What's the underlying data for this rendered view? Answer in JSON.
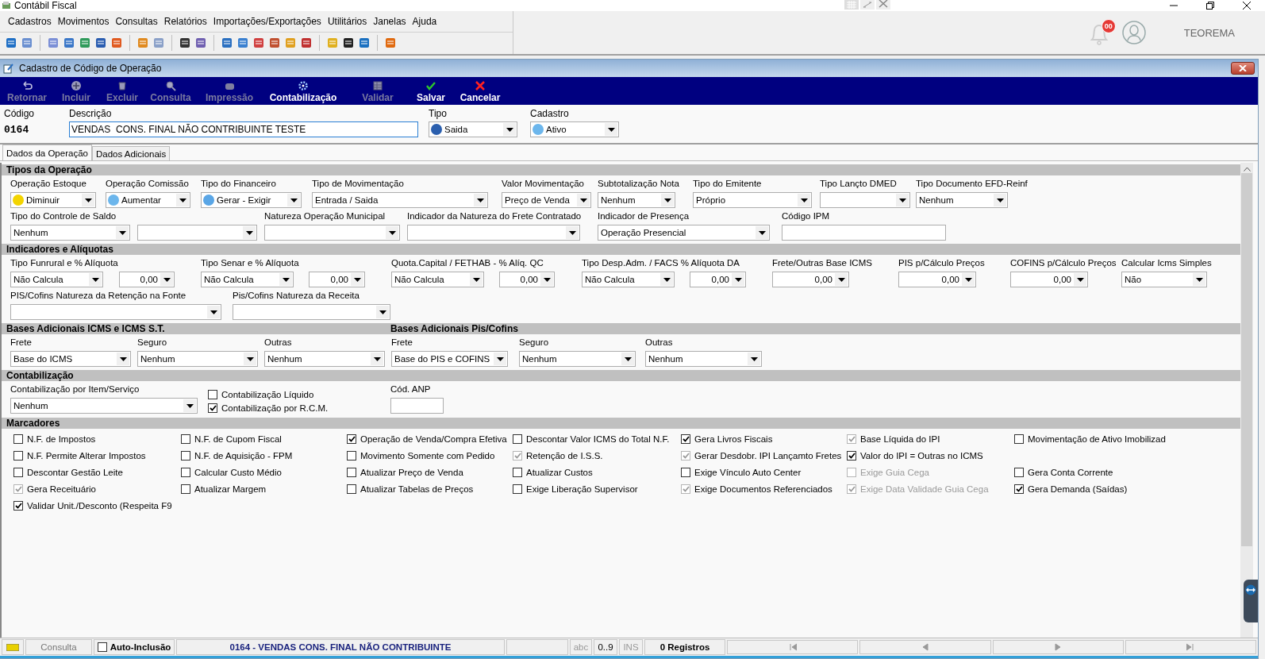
{
  "app_title": "Contábil Fiscal",
  "menu": [
    "Cadastros",
    "Movimentos",
    "Consultas",
    "Relatórios",
    "Importações/Exportações",
    "Utilitários",
    "Janelas",
    "Ajuda"
  ],
  "notifications": {
    "badge": "00"
  },
  "user_name": "TEOREMA",
  "form_window": {
    "title": "Cadastro de Código de Operação"
  },
  "actions": [
    {
      "label": "Retornar",
      "disabled": true
    },
    {
      "label": "Incluir",
      "disabled": true
    },
    {
      "label": "Excluir",
      "disabled": true
    },
    {
      "label": "Consulta",
      "disabled": true
    },
    {
      "label": "Impressão",
      "disabled": true
    },
    {
      "label": "Contabilização",
      "disabled": false
    },
    {
      "label": "Validar",
      "disabled": true
    },
    {
      "label": "Salvar",
      "disabled": false
    },
    {
      "label": "Cancelar",
      "disabled": false
    }
  ],
  "header": {
    "code_label": "Código",
    "code": "0164",
    "description_label": "Descrição",
    "description": "VENDAS  CONS. FINAL NÃO CONTRIBUINTE TESTE",
    "type": {
      "label": "Tipo",
      "value": "Saida",
      "color": "#2b5fae"
    },
    "status": {
      "label": "Cadastro",
      "value": "Ativo",
      "color": "#6cb6ec"
    }
  },
  "tabs": [
    {
      "label": "Dados da Operação",
      "selected": true
    },
    {
      "label": "Dados Adicionais",
      "selected": false
    }
  ],
  "sections": [
    {
      "kind": "fields",
      "titles": [
        "Tipos da Operação"
      ],
      "rows": [
        {
          "fields": [
            {
              "kind": "combo",
              "label": "Operação Estoque",
              "value": "Diminuir",
              "color": "#f3d400"
            },
            {
              "kind": "combo",
              "label": "Operação Comissão",
              "value": "Aumentar",
              "color": "#6cb6ec"
            },
            {
              "kind": "combo",
              "label": "Tipo do Financeiro",
              "value": "Gerar - Exigir",
              "color": "#5aa6e6"
            },
            {
              "kind": "combo",
              "label": "Tipo de Movimentação",
              "value": "Entrada / Saida"
            },
            {
              "kind": "combo",
              "label": "Valor Movimentação",
              "value": "Preço de Venda"
            },
            {
              "kind": "combo",
              "label": "Subtotalização Nota",
              "value": "Nenhum"
            },
            {
              "kind": "combo",
              "label": "Tipo do Emitente",
              "value": "Próprio"
            },
            {
              "kind": "combo",
              "label": "Tipo Lançto DMED"
            },
            {
              "kind": "combo",
              "label": "Tipo Documento EFD-Reinf",
              "value": "Nenhum"
            }
          ]
        },
        {
          "fields": [
            {
              "kind": "combo",
              "label": "Tipo do Controle de Saldo",
              "value": "Nenhum"
            },
            {
              "kind": "combo"
            },
            {
              "kind": "combo",
              "label": "Natureza Operação Municipal"
            },
            {
              "kind": "combo",
              "label": "Indicador da Natureza do Frete Contratado"
            },
            {
              "kind": "combo",
              "label": "Indicador de Presença",
              "value": "Operação Presencial"
            },
            {
              "kind": "text",
              "label": "Código IPM"
            }
          ]
        }
      ]
    },
    {
      "kind": "fields",
      "titles": [
        "Indicadores e Alíquotas"
      ],
      "rows": [
        {
          "fields": [
            {
              "kind": "combo",
              "label": "Tipo Funrural e % Alíquota",
              "value": "Não Calcula"
            },
            {
              "kind": "spin",
              "value": "0,00"
            },
            {
              "kind": "combo",
              "label": "Tipo Senar e % Alíquota",
              "value": "Não Calcula"
            },
            {
              "kind": "spin",
              "value": "0,00"
            },
            {
              "kind": "combo",
              "label": "Quota.Capital / FETHAB - % Alíq. QC",
              "value": "Não Calcula"
            },
            {
              "kind": "spin",
              "value": "0,00"
            },
            {
              "kind": "combo",
              "label": "Tipo Desp.Adm. / FACS % Alíquota DA",
              "value": "Não Calcula"
            },
            {
              "kind": "spin",
              "value": "0,00"
            },
            {
              "kind": "spin",
              "label": "Frete/Outras Base ICMS",
              "value": "0,00"
            },
            {
              "kind": "spin",
              "label": "PIS p/Cálculo Preços",
              "value": "0,00"
            },
            {
              "kind": "spin",
              "label": "COFINS p/Cálculo Preços",
              "value": "0,00"
            },
            {
              "kind": "combo",
              "label": "Calcular Icms Simples",
              "value": "Não"
            }
          ]
        },
        {
          "fields": [
            {
              "kind": "combo",
              "label": "PIS/Cofins Natureza da Retenção na Fonte"
            },
            {
              "kind": "combo",
              "label": "Pis/Cofins Natureza da Receita"
            }
          ]
        }
      ]
    },
    {
      "kind": "fields",
      "titles": [
        "Bases Adicionais ICMS e ICMS S.T.",
        "Bases Adicionais Pis/Cofins"
      ],
      "rows": [
        {
          "fields": [
            {
              "kind": "combo",
              "label": "Frete",
              "value": "Base do ICMS"
            },
            {
              "kind": "combo",
              "label": "Seguro",
              "value": "Nenhum"
            },
            {
              "kind": "combo",
              "label": "Outras",
              "value": "Nenhum"
            },
            {
              "kind": "combo",
              "label": "Frete",
              "value": "Base do PIS e COFINS"
            },
            {
              "kind": "combo",
              "label": "Seguro",
              "value": "Nenhum"
            },
            {
              "kind": "combo",
              "label": "Outras",
              "value": "Nenhum"
            }
          ]
        }
      ]
    },
    {
      "kind": "fields",
      "titles": [
        "Contabilização"
      ],
      "rows": [
        {
          "fields": [
            {
              "kind": "combo",
              "label": "Contabilização por Item/Serviço",
              "value": "Nenhum"
            },
            {
              "kind": "checks",
              "items": [
                {
                  "label": "Contabilização Líquido",
                  "checked": false
                },
                {
                  "label": "Contabilização por R.C.M.",
                  "checked": true
                }
              ]
            },
            {
              "kind": "text",
              "label": "Cód. ANP"
            }
          ]
        }
      ]
    },
    {
      "kind": "checks",
      "titles": [
        "Marcadores"
      ],
      "rows": [
        [
          {
            "label": "N.F. de Impostos",
            "checked": false,
            "disabled": false,
            "dimmed": false
          },
          {
            "label": "N.F. de Cupom Fiscal",
            "checked": false,
            "disabled": false,
            "dimmed": false
          },
          {
            "label": "Operação de Venda/Compra Efetiva",
            "checked": true,
            "disabled": false,
            "dimmed": false
          },
          {
            "label": "Descontar Valor ICMS do Total N.F.",
            "checked": false,
            "disabled": false,
            "dimmed": false
          },
          {
            "label": "Gera Livros Fiscais",
            "checked": true,
            "disabled": false,
            "dimmed": false
          },
          {
            "label": "Base Líquida do IPI",
            "checked": true,
            "disabled": true,
            "dimmed": false
          },
          {
            "label": "Movimentação de Ativo Imobilizad",
            "checked": false,
            "disabled": false,
            "dimmed": false
          }
        ],
        [
          {
            "label": "N.F. Permite Alterar Impostos",
            "checked": false,
            "disabled": false,
            "dimmed": false
          },
          {
            "label": "N.F. de Aquisição - FPM",
            "checked": false,
            "disabled": false,
            "dimmed": false
          },
          {
            "label": "Movimento Somente com Pedido",
            "checked": false,
            "disabled": false,
            "dimmed": false
          },
          {
            "label": "Retenção de I.S.S.",
            "checked": true,
            "disabled": true,
            "dimmed": false
          },
          {
            "label": "Gerar Desdobr. IPI Lançamto Fretes",
            "checked": true,
            "disabled": true,
            "dimmed": false
          },
          {
            "label": "Valor do IPI = Outras no ICMS",
            "checked": true,
            "disabled": false,
            "dimmed": false
          }
        ],
        [
          {
            "label": "Descontar Gestão Leite",
            "checked": false,
            "disabled": false,
            "dimmed": false
          },
          {
            "label": "Calcular Custo Médio",
            "checked": false,
            "disabled": false,
            "dimmed": false
          },
          {
            "label": "Atualizar Preço de Venda",
            "checked": false,
            "disabled": false,
            "dimmed": false
          },
          {
            "label": "Atualizar Custos",
            "checked": false,
            "disabled": false,
            "dimmed": false
          },
          {
            "label": "Exige Vínculo Auto Center",
            "checked": false,
            "disabled": false,
            "dimmed": false
          },
          {
            "label": "Exige Guia Cega",
            "checked": false,
            "disabled": true,
            "dimmed": true
          },
          {
            "label": "Gera Conta Corrente",
            "checked": false,
            "disabled": false,
            "dimmed": false
          }
        ],
        [
          {
            "label": "Gera Receituário",
            "checked": true,
            "disabled": true,
            "dimmed": false
          },
          {
            "label": "Atualizar Margem",
            "checked": false,
            "disabled": false,
            "dimmed": false
          },
          {
            "label": "Atualizar Tabelas de Preços",
            "checked": false,
            "disabled": false,
            "dimmed": false
          },
          {
            "label": "Exige Liberação Supervisor",
            "checked": false,
            "disabled": false,
            "dimmed": false
          },
          {
            "label": "Exige Documentos Referenciados",
            "checked": true,
            "disabled": true,
            "dimmed": false
          },
          {
            "label": "Exige Data Validade Guia Cega",
            "checked": true,
            "disabled": true,
            "dimmed": true
          },
          {
            "label": "Gera Demanda (Saídas)",
            "checked": true,
            "disabled": false,
            "dimmed": false
          }
        ],
        [
          {
            "label": "Validar Unit./Desconto (Respeita F9",
            "checked": true,
            "disabled": false,
            "dimmed": false
          }
        ]
      ]
    }
  ],
  "status_bar": {
    "mode": "Consulta",
    "auto_include": {
      "label": "Auto-Inclusão",
      "checked": false
    },
    "record": "0164 - VENDAS  CONS. FINAL NÃO CONTRIBUINTE",
    "indicators": [
      "abc",
      "0..9",
      "INS"
    ],
    "count": "0 Registros"
  }
}
